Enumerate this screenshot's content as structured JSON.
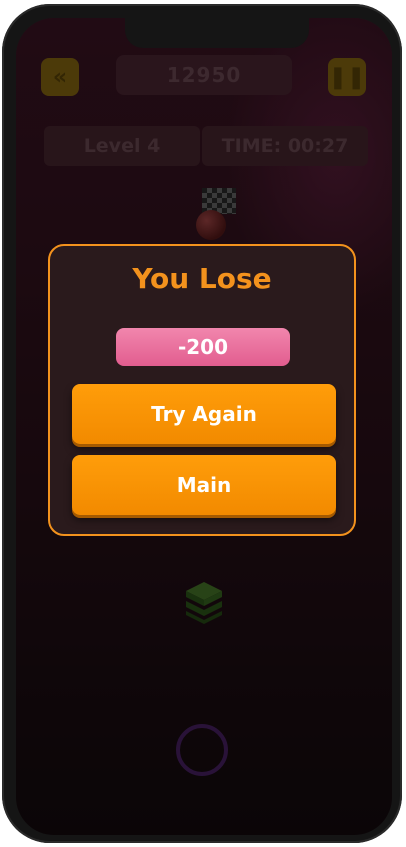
{
  "hud": {
    "score": "12950",
    "level": "Level 4",
    "time": "TIME: 00:27"
  },
  "dialog": {
    "title": "You Lose",
    "penalty": "-200",
    "try_again_label": "Try Again",
    "main_label": "Main"
  },
  "colors": {
    "accent_orange": "#f3921d",
    "penalty_pink": "#e25d8f",
    "background": "#2a1019"
  },
  "icons": {
    "back": "double-chevron-left-icon",
    "pause": "pause-icon",
    "goal": "checkered-flag-icon",
    "player": "ball-icon",
    "blocks": "stack-icon",
    "control": "ring-button-icon"
  }
}
